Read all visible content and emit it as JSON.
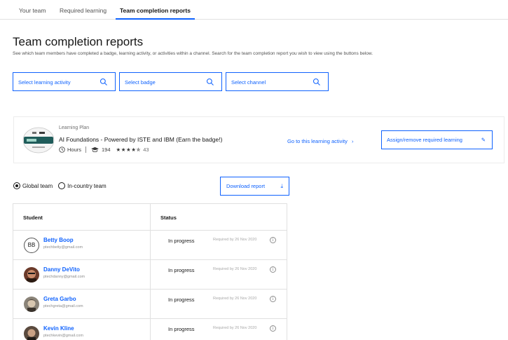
{
  "tabs": [
    {
      "label": "Your team"
    },
    {
      "label": "Required learning"
    },
    {
      "label": "Team completion reports",
      "active": true
    }
  ],
  "page": {
    "title": "Team completion reports",
    "description": "See which team members have completed a badge, learning activity, or activities within a channel. Search for the team completion report you wish to view using the buttons below."
  },
  "search": [
    {
      "placeholder": "Select learning activity",
      "icon": "search-icon"
    },
    {
      "placeholder": "Select badge",
      "icon": "search-icon"
    },
    {
      "placeholder": "Select channel",
      "icon": "search-icon"
    }
  ],
  "plan": {
    "kind": "Learning Plan",
    "title": "AI Foundations - Powered by ISTE and IBM (Earn the badge!)",
    "duration": "Hours",
    "learners": "194",
    "rating_stars": "★★★★✯",
    "rating_count": "43",
    "goto_label": "Go to this learning activity",
    "goto_icon": "chevron-right-icon",
    "assign_label": "Assign/remove required learning",
    "assign_icon": "edit-icon"
  },
  "team_filter": {
    "options": [
      "Global team",
      "In-country team"
    ],
    "selected": "Global team"
  },
  "download_label": "Download report",
  "download_icon": "download-icon",
  "table": {
    "headers": {
      "student": "Student",
      "status": "Status"
    },
    "rows": [
      {
        "initials": "BB",
        "name": "Betty Boop",
        "email": "ptechbetty@gmail.com",
        "status": "In progress",
        "required": "Required by 26 Nov 2020"
      },
      {
        "name": "Danny DeVito",
        "email": "ptechdanny@gmail.com",
        "status": "In progress",
        "required": "Required by 26 Nov 2020"
      },
      {
        "name": "Greta Garbo",
        "email": "ptechgreta@gmail.com",
        "status": "In progress",
        "required": "Required by 26 Nov 2020"
      },
      {
        "name": "Kevin Kline",
        "email": "ptechkevin@gmail.com",
        "status": "In progress",
        "required": "Required by 26 Nov 2020"
      }
    ]
  },
  "colors": {
    "accent": "#0f62fe",
    "text": "#161616",
    "muted": "#525252",
    "border": "#e0e0e0"
  }
}
